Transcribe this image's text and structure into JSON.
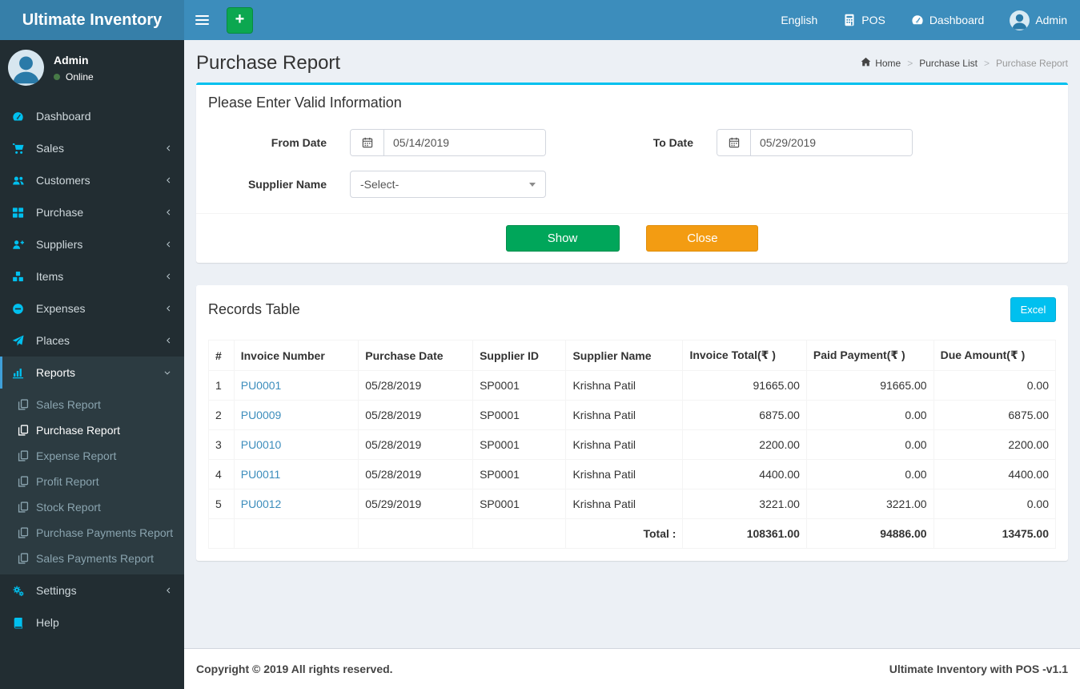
{
  "app": {
    "title": "Ultimate Inventory",
    "footer_left": "Copyright © 2019 All rights reserved.",
    "footer_right": "Ultimate Inventory with POS -v1.1"
  },
  "colors": {
    "navbar": "#3c8dbc",
    "logo_bg": "#367fa9",
    "sidebar_bg": "#222d32",
    "accent_cyan": "#00c0ef",
    "button_green": "#00a65a",
    "button_orange": "#f39c12",
    "link_blue": "#3c8dbc",
    "add_button_green": "#0ca750"
  },
  "navbar": {
    "language": "English",
    "pos_label": "POS",
    "dashboard_label": "Dashboard",
    "user_label": "Admin",
    "add_label": "+"
  },
  "sidebar": {
    "user": {
      "name": "Admin",
      "status": "Online"
    },
    "items": [
      {
        "label": "Dashboard"
      },
      {
        "label": "Sales"
      },
      {
        "label": "Customers"
      },
      {
        "label": "Purchase"
      },
      {
        "label": "Suppliers"
      },
      {
        "label": "Items"
      },
      {
        "label": "Expenses"
      },
      {
        "label": "Places"
      },
      {
        "label": "Reports"
      },
      {
        "label": "Settings"
      },
      {
        "label": "Help"
      }
    ],
    "reports_submenu": [
      {
        "label": "Sales Report"
      },
      {
        "label": "Purchase Report"
      },
      {
        "label": "Expense Report"
      },
      {
        "label": "Profit Report"
      },
      {
        "label": "Stock Report"
      },
      {
        "label": "Purchase Payments Report"
      },
      {
        "label": "Sales Payments Report"
      }
    ]
  },
  "page": {
    "title": "Purchase Report",
    "breadcrumb": {
      "home": "Home",
      "mid": "Purchase List",
      "current": "Purchase Report"
    }
  },
  "filter": {
    "heading": "Please Enter Valid Information",
    "from_label": "From Date",
    "from_value": "05/14/2019",
    "to_label": "To Date",
    "to_value": "05/29/2019",
    "supplier_label": "Supplier Name",
    "supplier_value": "-Select-",
    "show_label": "Show",
    "close_label": "Close"
  },
  "records": {
    "heading": "Records Table",
    "excel_label": "Excel",
    "columns": [
      "#",
      "Invoice Number",
      "Purchase Date",
      "Supplier ID",
      "Supplier Name",
      "Invoice Total(₹ )",
      "Paid Payment(₹ )",
      "Due Amount(₹ )"
    ],
    "rows": [
      [
        "1",
        "PU0001",
        "05/28/2019",
        "SP0001",
        "Krishna Patil",
        "91665.00",
        "91665.00",
        "0.00"
      ],
      [
        "2",
        "PU0009",
        "05/28/2019",
        "SP0001",
        "Krishna Patil",
        "6875.00",
        "0.00",
        "6875.00"
      ],
      [
        "3",
        "PU0010",
        "05/28/2019",
        "SP0001",
        "Krishna Patil",
        "2200.00",
        "0.00",
        "2200.00"
      ],
      [
        "4",
        "PU0011",
        "05/28/2019",
        "SP0001",
        "Krishna Patil",
        "4400.00",
        "0.00",
        "4400.00"
      ],
      [
        "5",
        "PU0012",
        "05/29/2019",
        "SP0001",
        "Krishna Patil",
        "3221.00",
        "3221.00",
        "0.00"
      ]
    ],
    "total_label": "Total :",
    "totals": [
      "108361.00",
      "94886.00",
      "13475.00"
    ]
  }
}
